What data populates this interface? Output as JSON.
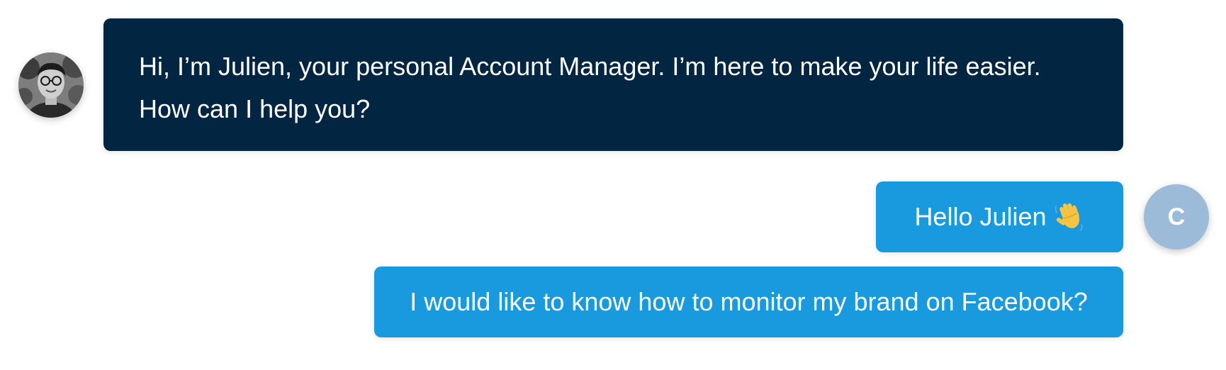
{
  "chat": {
    "agent": {
      "avatar_icon": "agent-photo-avatar",
      "message_lines": [
        "Hi, I’m Julien, your personal Account Manager. I’m here to make your life easier.",
        "How can I help you?"
      ]
    },
    "user": {
      "avatar_initial": "C",
      "messages": [
        {
          "text": "Hello Julien",
          "emoji_icon": "waving-hand-icon"
        },
        {
          "text": "I would like to know how to monitor my brand on Facebook?"
        }
      ]
    }
  },
  "colors": {
    "agent_bubble": "#022542",
    "user_bubble": "#199ade",
    "user_avatar": "#9bbbd8",
    "text_on_bubble": "#ffffff"
  }
}
